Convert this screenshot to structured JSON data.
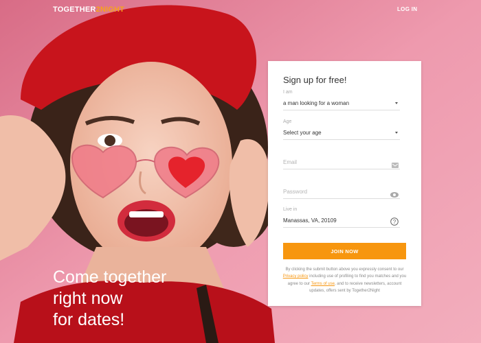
{
  "header": {
    "logo_main": "TOGETHER",
    "logo_accent": "2NIGHT",
    "login_label": "LOG IN"
  },
  "hero": {
    "tagline_lines": [
      "Come together",
      "right now",
      "for dates!"
    ]
  },
  "signup": {
    "title": "Sign up for free!",
    "iam_label": "I am",
    "iam_value": "a man looking for a woman",
    "age_label": "Age",
    "age_value": "Select your age",
    "email_placeholder": "Email",
    "password_placeholder": "Password",
    "livein_label": "Live in",
    "livein_value": "Manassas, VA, 20109",
    "join_label": "JOIN NOW",
    "consent": {
      "part1": "By clicking the submit button above you expressly consent to our",
      "privacy_link": "Privacy policy",
      "part2": "including use of profiling to find you matches and you agree to our",
      "terms_link": "Terms of use",
      "part3": ", and to receive newsletters, account updates, offers sent by Together2Night"
    }
  },
  "colors": {
    "accent": "#f7960f",
    "background": "#e98aa0",
    "hat": "#c8141c"
  },
  "icons": [
    "email-icon",
    "password-eye-icon",
    "help-icon",
    "chevron-down-icon"
  ]
}
